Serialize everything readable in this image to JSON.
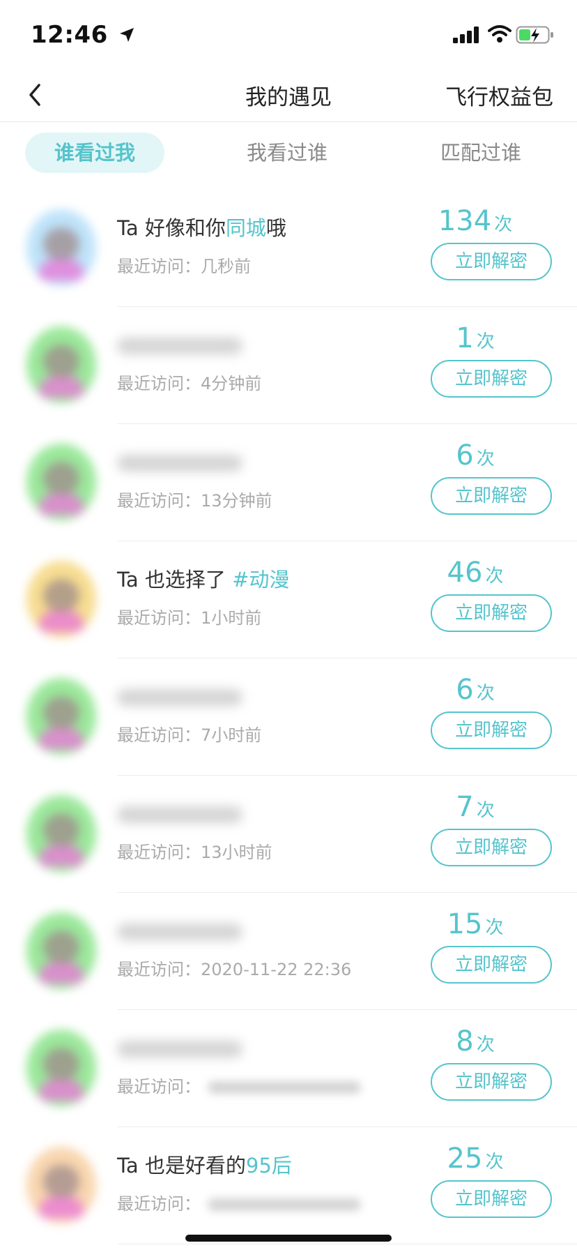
{
  "status_bar": {
    "time": "12:46"
  },
  "nav": {
    "title": "我的遇见",
    "action": "飞行权益包"
  },
  "tabs": [
    {
      "label": "谁看过我",
      "active": true
    },
    {
      "label": "我看过谁",
      "active": false
    },
    {
      "label": "匹配过谁",
      "active": false
    }
  ],
  "visit_prefix": "最近访问：",
  "unlock_label": "立即解密",
  "count_unit": "次",
  "rows": [
    {
      "name_prefix": "Ta 好像和你",
      "name_highlight": "同城",
      "name_suffix": "哦",
      "visit_time": "几秒前",
      "count": "134",
      "avatar_color": "#bfe3fa"
    },
    {
      "name_prefix": "",
      "name_highlight": "",
      "name_suffix": "",
      "visit_time": "4分钟前",
      "count": "1",
      "avatar_color": "#9be89b"
    },
    {
      "name_prefix": "",
      "name_highlight": "",
      "name_suffix": "",
      "visit_time": "13分钟前",
      "count": "6",
      "avatar_color": "#9be89b"
    },
    {
      "name_prefix": "Ta 也选择了 ",
      "name_highlight": "#动漫",
      "name_suffix": "",
      "visit_time": "1小时前",
      "count": "46",
      "avatar_color": "#f7dd91"
    },
    {
      "name_prefix": "",
      "name_highlight": "",
      "name_suffix": "",
      "visit_time": "7小时前",
      "count": "6",
      "avatar_color": "#9be89b"
    },
    {
      "name_prefix": "",
      "name_highlight": "",
      "name_suffix": "",
      "visit_time": "13小时前",
      "count": "7",
      "avatar_color": "#9be89b"
    },
    {
      "name_prefix": "",
      "name_highlight": "",
      "name_suffix": "",
      "visit_time": "2020-11-22 22:36",
      "count": "15",
      "avatar_color": "#9be89b"
    },
    {
      "name_prefix": "",
      "name_highlight": "",
      "name_suffix": "",
      "visit_time": "",
      "count": "8",
      "avatar_color": "#9be89b"
    },
    {
      "name_prefix": "Ta 也是好看的",
      "name_highlight": "95后",
      "name_suffix": "",
      "visit_time": "",
      "count": "25",
      "avatar_color": "#f9d6b0"
    }
  ],
  "colors": {
    "accent": "#55c4cc",
    "tab_active_bg": "#e3f6f7",
    "muted_text": "#aaaaaa"
  }
}
